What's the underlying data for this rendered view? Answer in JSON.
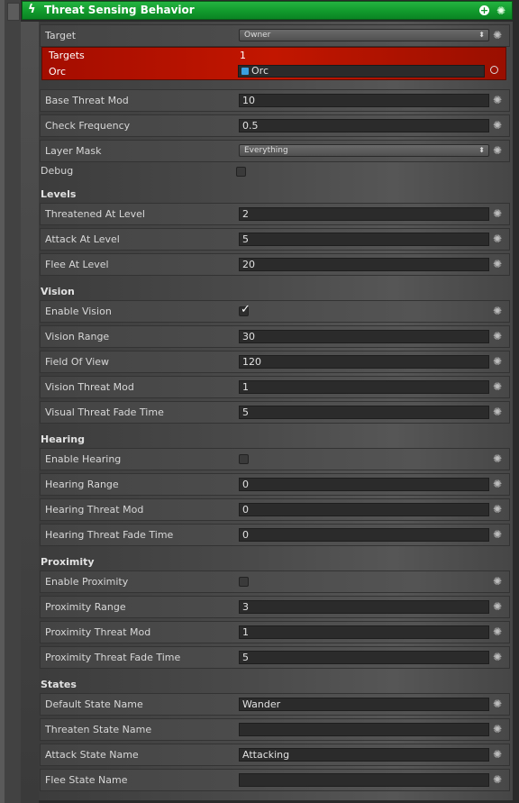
{
  "component": {
    "title": "Threat Sensing Behavior"
  },
  "target": {
    "label": "Target",
    "value": "Owner"
  },
  "targets_box": {
    "targets_label": "Targets",
    "targets_value": "1",
    "object_label": "Orc",
    "object_value": "Orc"
  },
  "base_threat_mod": {
    "label": "Base Threat Mod",
    "value": "10"
  },
  "check_frequency": {
    "label": "Check Frequency",
    "value": "0.5"
  },
  "layer_mask": {
    "label": "Layer Mask",
    "value": "Everything"
  },
  "debug": {
    "label": "Debug",
    "checked": false
  },
  "levels": {
    "header": "Levels",
    "threatened": {
      "label": "Threatened At Level",
      "value": "2"
    },
    "attack": {
      "label": "Attack At Level",
      "value": "5"
    },
    "flee": {
      "label": "Flee At Level",
      "value": "20"
    }
  },
  "vision": {
    "header": "Vision",
    "enable": {
      "label": "Enable Vision",
      "checked": true
    },
    "range": {
      "label": "Vision Range",
      "value": "30"
    },
    "fov": {
      "label": "Field Of View",
      "value": "120"
    },
    "threat_mod": {
      "label": "Vision Threat Mod",
      "value": "1"
    },
    "fade": {
      "label": "Visual Threat Fade Time",
      "value": "5"
    }
  },
  "hearing": {
    "header": "Hearing",
    "enable": {
      "label": "Enable Hearing",
      "checked": false
    },
    "range": {
      "label": "Hearing Range",
      "value": "0"
    },
    "threat_mod": {
      "label": "Hearing Threat Mod",
      "value": "0"
    },
    "fade": {
      "label": "Hearing Threat Fade Time",
      "value": "0"
    }
  },
  "proximity": {
    "header": "Proximity",
    "enable": {
      "label": "Enable Proximity",
      "checked": false
    },
    "range": {
      "label": "Proximity Range",
      "value": "3"
    },
    "threat_mod": {
      "label": "Proximity Threat Mod",
      "value": "1"
    },
    "fade": {
      "label": "Proximity Threat Fade Time",
      "value": "5"
    }
  },
  "states": {
    "header": "States",
    "default": {
      "label": "Default State Name",
      "value": "Wander"
    },
    "threaten": {
      "label": "Threaten State Name",
      "value": ""
    },
    "attack": {
      "label": "Attack State Name",
      "value": "Attacking"
    },
    "flee": {
      "label": "Flee State Name",
      "value": ""
    }
  },
  "icons": {
    "bolt": "lightning-icon",
    "add": "add-circle-icon",
    "settings": "gear-icon",
    "picker": "object-picker-icon"
  },
  "colors": {
    "header_green": "#119a2c",
    "error_red": "#c21600"
  }
}
